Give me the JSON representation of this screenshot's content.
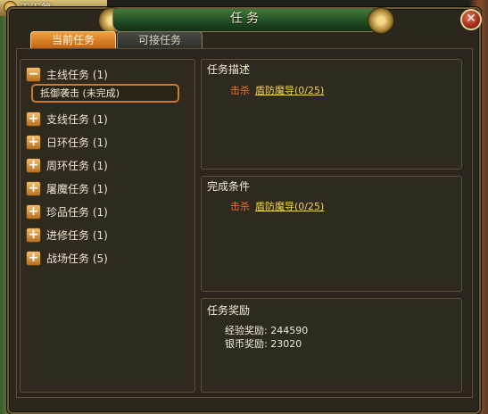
{
  "background": {
    "top_left_text": "天下第"
  },
  "window": {
    "title": "任务",
    "close_symbol": "✕"
  },
  "tabs": [
    {
      "label": "当前任务",
      "active": true
    },
    {
      "label": "可接任务",
      "active": false
    }
  ],
  "quest_categories": [
    {
      "label": "主线任务 (1)",
      "expanded": true,
      "toggle": "−"
    },
    {
      "label": "支线任务 (1)",
      "expanded": false,
      "toggle": "+"
    },
    {
      "label": "日环任务 (1)",
      "expanded": false,
      "toggle": "+"
    },
    {
      "label": "周环任务 (1)",
      "expanded": false,
      "toggle": "+"
    },
    {
      "label": "屠魔任务 (1)",
      "expanded": false,
      "toggle": "+"
    },
    {
      "label": "珍品任务 (1)",
      "expanded": false,
      "toggle": "+"
    },
    {
      "label": "进修任务 (1)",
      "expanded": false,
      "toggle": "+"
    },
    {
      "label": "战场任务 (5)",
      "expanded": false,
      "toggle": "+"
    }
  ],
  "selected_quest": {
    "label": "抵御袭击 (未完成)"
  },
  "description": {
    "heading": "任务描述",
    "verb": "击杀",
    "target": "盾防魔导(0/25)"
  },
  "conditions": {
    "heading": "完成条件",
    "verb": "击杀",
    "target": "盾防魔导(0/25)"
  },
  "rewards": {
    "heading": "任务奖励",
    "exp": "经验奖励: 244590",
    "silver": "银币奖励: 23020"
  },
  "colors": {
    "accent_orange": "#d0782a",
    "kill_verb": "#ee6f2a",
    "target_link": "#f5d05a",
    "title_green": "#1f4a22"
  }
}
